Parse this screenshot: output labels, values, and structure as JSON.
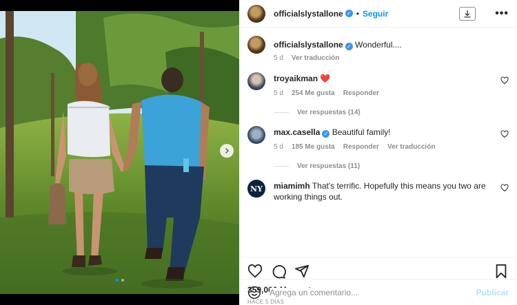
{
  "header": {
    "username": "officialslystallone",
    "separator": "•",
    "follow_label": "Seguir",
    "more_label": "•••"
  },
  "caption": {
    "username": "officialslystallone",
    "text": "Wonderful....",
    "time": "5 d",
    "translate_label": "Ver traducción"
  },
  "comments": [
    {
      "username": "troyaikman",
      "text": "",
      "emoji": "❤️",
      "time": "5 d",
      "likes": "254 Me gusta",
      "reply_label": "Responder",
      "view_replies": "Ver respuestas (14)"
    },
    {
      "username": "max.casella",
      "text": "Beautiful family!",
      "time": "5 d",
      "likes": "185 Me gusta",
      "reply_label": "Responder",
      "translate_label": "Ver traducción",
      "view_replies": "Ver respuestas (11)"
    },
    {
      "username": "miamimh",
      "text": "That's terrific. Hopefully this means you two are working things out.",
      "avatar_text": "NY"
    }
  ],
  "post": {
    "likes": "359,000 Me gusta",
    "date": "HACE 5 DÍAS"
  },
  "comment_box": {
    "placeholder": "Agrega un comentario...",
    "publish_label": "Publicar"
  },
  "carousel": {
    "slides": 2,
    "active": 1
  },
  "colors": {
    "accent": "#0095f6",
    "verified": "#3897f0",
    "publish_disabled": "#b2dffc",
    "heart": "#ed4956"
  },
  "icons": [
    "verified-badge-icon",
    "download-icon",
    "more-icon",
    "heart-icon",
    "comment-icon",
    "share-icon",
    "bookmark-icon",
    "emoji-icon",
    "chevron-right-icon"
  ]
}
